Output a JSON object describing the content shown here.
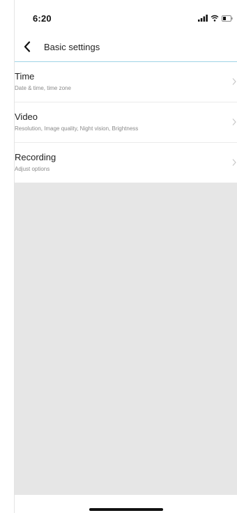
{
  "status_bar": {
    "time": "6:20",
    "icons": [
      "signal-icon",
      "wifi-icon",
      "battery-icon"
    ]
  },
  "nav": {
    "back_icon": "chevron-left-icon",
    "title": "Basic settings"
  },
  "settings": [
    {
      "title": "Time",
      "subtitle": "Date & time, time zone"
    },
    {
      "title": "Video",
      "subtitle": "Resolution, Image quality, Night vision, Brightness"
    },
    {
      "title": "Recording",
      "subtitle": "Adjust options"
    }
  ],
  "colors": {
    "nav_divider": "#9fd3e6",
    "background_grey": "#e6e6e6",
    "chevron": "#c8c8c8"
  }
}
